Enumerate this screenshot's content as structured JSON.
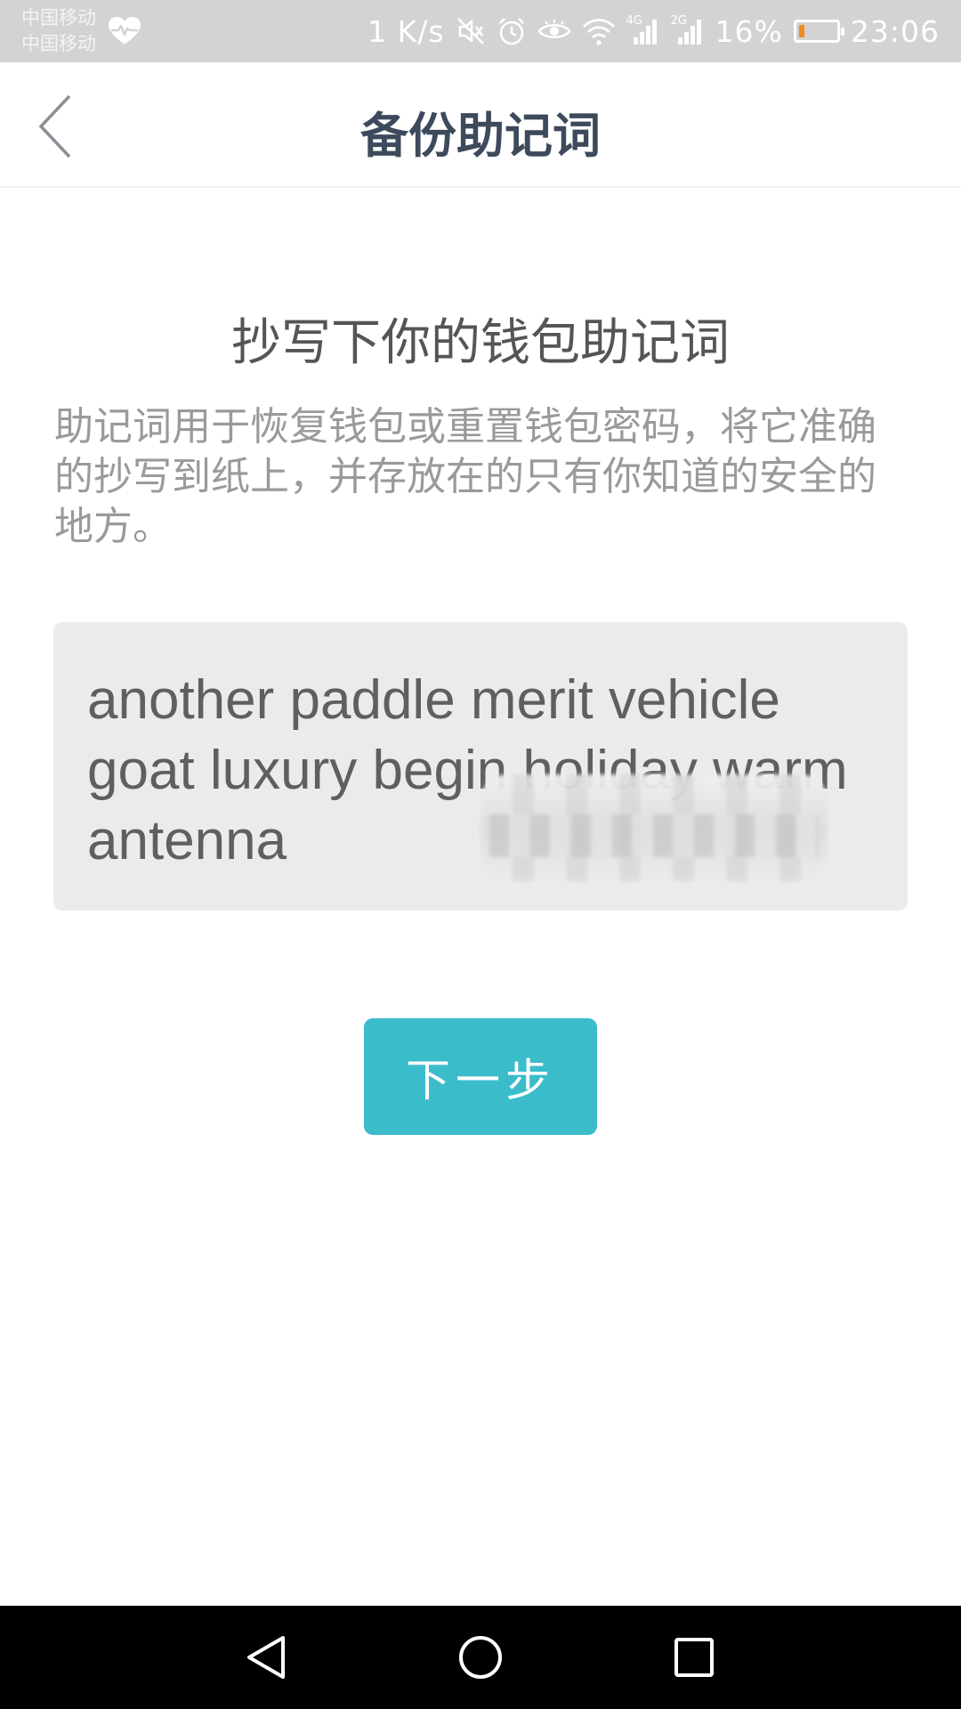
{
  "status_bar": {
    "carrier_line1": "中国移动",
    "carrier_line2": "中国移动",
    "network_speed": "1 K/s",
    "signal_label_1": "4G",
    "signal_label_2": "2G",
    "battery_percent": "16%",
    "battery_level": 0.16,
    "time": "23:06",
    "icons": [
      "heart-rate-icon",
      "mute-icon",
      "alarm-icon",
      "eye-icon",
      "wifi-icon",
      "signal-icon",
      "signal-icon",
      "battery-icon"
    ]
  },
  "header": {
    "title": "备份助记词",
    "back_icon": "chevron-left-icon"
  },
  "content": {
    "heading": "抄写下你的钱包助记词",
    "description": "助记词用于恢复钱包或重置钱包密码，将它准确的抄写到纸上，并存放在的只有你知道的安全的地方。",
    "mnemonic": "another paddle merit vehicle goat luxury begin holiday warm antenna"
  },
  "actions": {
    "next_label": "下一步"
  },
  "nav_bar": {
    "icons": [
      "nav-back-icon",
      "nav-home-icon",
      "nav-recent-icon"
    ]
  },
  "colors": {
    "accent": "#3bbccb",
    "title": "#3d4a5c",
    "status_bar_bg": "#d3d3d3",
    "mnemonic_bg": "#ebebeb",
    "battery_low": "#f08a24"
  }
}
